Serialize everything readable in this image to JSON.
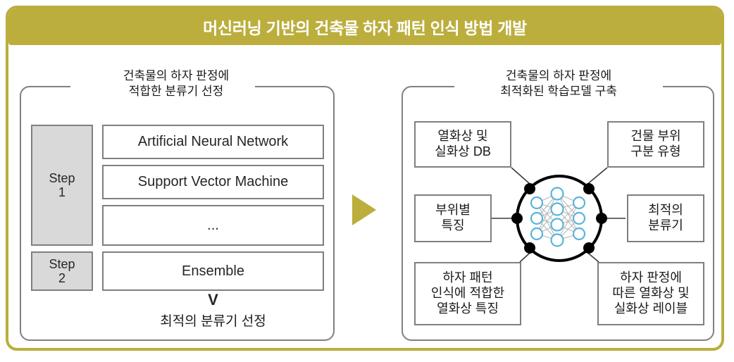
{
  "colors": {
    "gold": "#BBAE3C",
    "panel_border": "#808080",
    "box_border": "#7F7F7F",
    "step_fill": "#D9D9D9",
    "nn_node": "#5BB4D8",
    "hub_line": "#000000"
  },
  "header": {
    "title": "머신러닝 기반의 건축물 하자 패턴 인식 방법 개발"
  },
  "flow_arrow": {
    "icon": "triangle-right-icon"
  },
  "left_panel": {
    "caption_line1": "건축물의 하자 판정에",
    "caption_line2": "적합한 분류기 선정",
    "steps": [
      {
        "label": "Step",
        "number": "1"
      },
      {
        "label": "Step",
        "number": "2"
      }
    ],
    "classifiers": [
      "Artificial Neural Network",
      "Support Vector Machine",
      "...",
      "Ensemble"
    ],
    "chevron": "V",
    "conclusion": "최적의 분류기 선정"
  },
  "right_panel": {
    "caption_line1": "건축물의 하자 판정에",
    "caption_line2": "최적화된 학습모델 구축",
    "hub": {
      "icon": "neural-network-icon",
      "input_nodes": 3,
      "hidden_nodes": 4,
      "output_nodes": 3,
      "connector_dots": 6
    },
    "nodes": {
      "top_left": [
        "열화상 및",
        "실화상 DB"
      ],
      "top_right": [
        "건물 부위",
        "구분 유형"
      ],
      "middle_left": [
        "부위별",
        "특징"
      ],
      "middle_right": [
        "최적의",
        "분류기"
      ],
      "bottom_left": [
        "하자 패턴",
        "인식에 적합한",
        "열화상 특징"
      ],
      "bottom_right": [
        "하자 판정에",
        "따른 열화상 및",
        "실화상 레이블"
      ]
    }
  }
}
